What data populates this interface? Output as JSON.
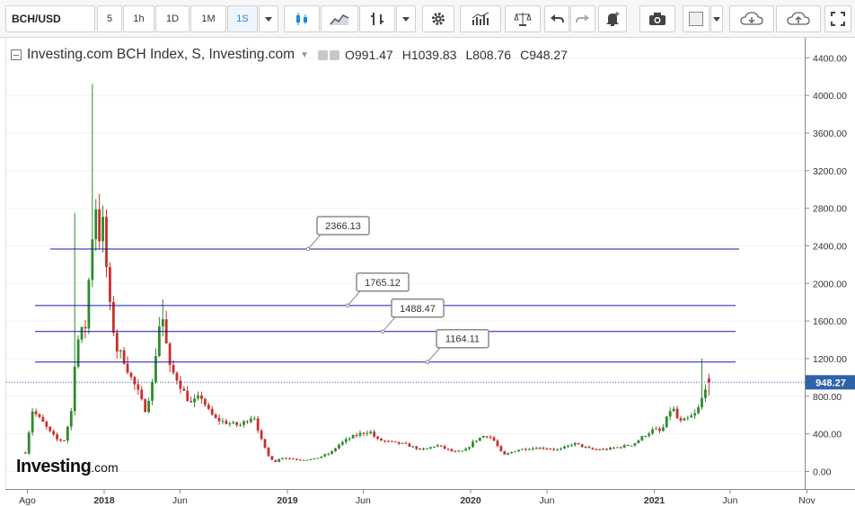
{
  "toolbar": {
    "symbol": "BCH/USD",
    "intervals": [
      "5",
      "1h",
      "1D",
      "1M",
      "1S"
    ],
    "active_interval": "1S"
  },
  "legend": {
    "title": "Investing.com BCH Index, S, Investing.com",
    "open_label": "O",
    "open": "991.47",
    "high_label": "H",
    "high": "1039.83",
    "low_label": "L",
    "low": "808.76",
    "close_label": "C",
    "close": "948.27"
  },
  "logo": {
    "brand": "Investing",
    "suffix": ".com"
  },
  "colors": {
    "up": "#2e8b2e",
    "down": "#c9302c",
    "level_line": "#1a1aa8",
    "price_line": "#2f63a8"
  },
  "chart_data": {
    "type": "candlestick",
    "title": "Investing.com BCH Index, S, Investing.com",
    "x_tick_labels": [
      "Ago",
      "2018",
      "Jun",
      "2019",
      "Jun",
      "2020",
      "Jun",
      "2021",
      "Jun",
      "Nov"
    ],
    "y_ticks": [
      0,
      400,
      800,
      1200,
      1600,
      2000,
      2400,
      2800,
      3200,
      3600,
      4000,
      4400
    ],
    "y_tick_labels": [
      "0.00",
      "400.00",
      "800.00",
      "1200.00",
      "1600.00",
      "2000.00",
      "2400.00",
      "2800.00",
      "3200.00",
      "3600.00",
      "4000.00",
      "4400.00"
    ],
    "ylim": [
      -100,
      4580
    ],
    "last_price": 948.27,
    "last_price_label": "948.27",
    "levels": [
      {
        "value": 2366.13,
        "label": "2366.13"
      },
      {
        "value": 1765.12,
        "label": "1765.12"
      },
      {
        "value": 1488.47,
        "label": "1488.47"
      },
      {
        "value": 1164.11,
        "label": "1164.11"
      }
    ],
    "anchors": [
      [
        "2017-08-06",
        200
      ],
      [
        "2017-08-20",
        650
      ],
      [
        "2017-09-10",
        520
      ],
      [
        "2017-09-24",
        420
      ],
      [
        "2017-10-08",
        340
      ],
      [
        "2017-10-22",
        330
      ],
      [
        "2017-11-05",
        620
      ],
      [
        "2017-11-12",
        1150
      ],
      [
        "2017-11-19",
        1400
      ],
      [
        "2017-11-26",
        1480
      ],
      [
        "2017-12-03",
        1520
      ],
      [
        "2017-12-17",
        2500
      ],
      [
        "2017-12-24",
        2850
      ],
      [
        "2017-12-31",
        2500
      ],
      [
        "2018-01-07",
        2650
      ],
      [
        "2018-01-21",
        1750
      ],
      [
        "2018-02-04",
        1300
      ],
      [
        "2018-02-18",
        1200
      ],
      [
        "2018-03-04",
        1000
      ],
      [
        "2018-03-18",
        850
      ],
      [
        "2018-04-01",
        650
      ],
      [
        "2018-04-15",
        900
      ],
      [
        "2018-04-29",
        1550
      ],
      [
        "2018-05-06",
        1650
      ],
      [
        "2018-05-20",
        1100
      ],
      [
        "2018-06-03",
        1000
      ],
      [
        "2018-06-17",
        850
      ],
      [
        "2018-07-01",
        720
      ],
      [
        "2018-07-22",
        800
      ],
      [
        "2018-08-05",
        650
      ],
      [
        "2018-08-19",
        560
      ],
      [
        "2018-09-09",
        520
      ],
      [
        "2018-10-07",
        490
      ],
      [
        "2018-11-04",
        600
      ],
      [
        "2018-11-18",
        350
      ],
      [
        "2018-12-02",
        170
      ],
      [
        "2018-12-16",
        100
      ],
      [
        "2018-12-30",
        150
      ],
      [
        "2019-02-03",
        125
      ],
      [
        "2019-03-03",
        130
      ],
      [
        "2019-04-07",
        200
      ],
      [
        "2019-04-21",
        280
      ],
      [
        "2019-05-12",
        350
      ],
      [
        "2019-06-02",
        400
      ],
      [
        "2019-06-23",
        430
      ],
      [
        "2019-07-07",
        340
      ],
      [
        "2019-08-04",
        310
      ],
      [
        "2019-09-01",
        290
      ],
      [
        "2019-10-06",
        225
      ],
      [
        "2019-11-03",
        280
      ],
      [
        "2019-12-08",
        205
      ],
      [
        "2019-12-29",
        220
      ],
      [
        "2020-01-19",
        330
      ],
      [
        "2020-02-09",
        390
      ],
      [
        "2020-02-23",
        350
      ],
      [
        "2020-03-15",
        170
      ],
      [
        "2020-04-12",
        230
      ],
      [
        "2020-05-10",
        250
      ],
      [
        "2020-06-07",
        250
      ],
      [
        "2020-07-05",
        230
      ],
      [
        "2020-08-02",
        300
      ],
      [
        "2020-09-06",
        235
      ],
      [
        "2020-10-04",
        235
      ],
      [
        "2020-11-01",
        260
      ],
      [
        "2020-11-29",
        290
      ],
      [
        "2020-12-20",
        380
      ],
      [
        "2021-01-10",
        450
      ],
      [
        "2021-01-24",
        420
      ],
      [
        "2021-02-14",
        700
      ],
      [
        "2021-02-28",
        520
      ],
      [
        "2021-03-14",
        550
      ],
      [
        "2021-04-04",
        620
      ],
      [
        "2021-04-18",
        820
      ],
      [
        "2021-04-25",
        991.47
      ],
      [
        "2021-05-02",
        948.27
      ]
    ]
  }
}
